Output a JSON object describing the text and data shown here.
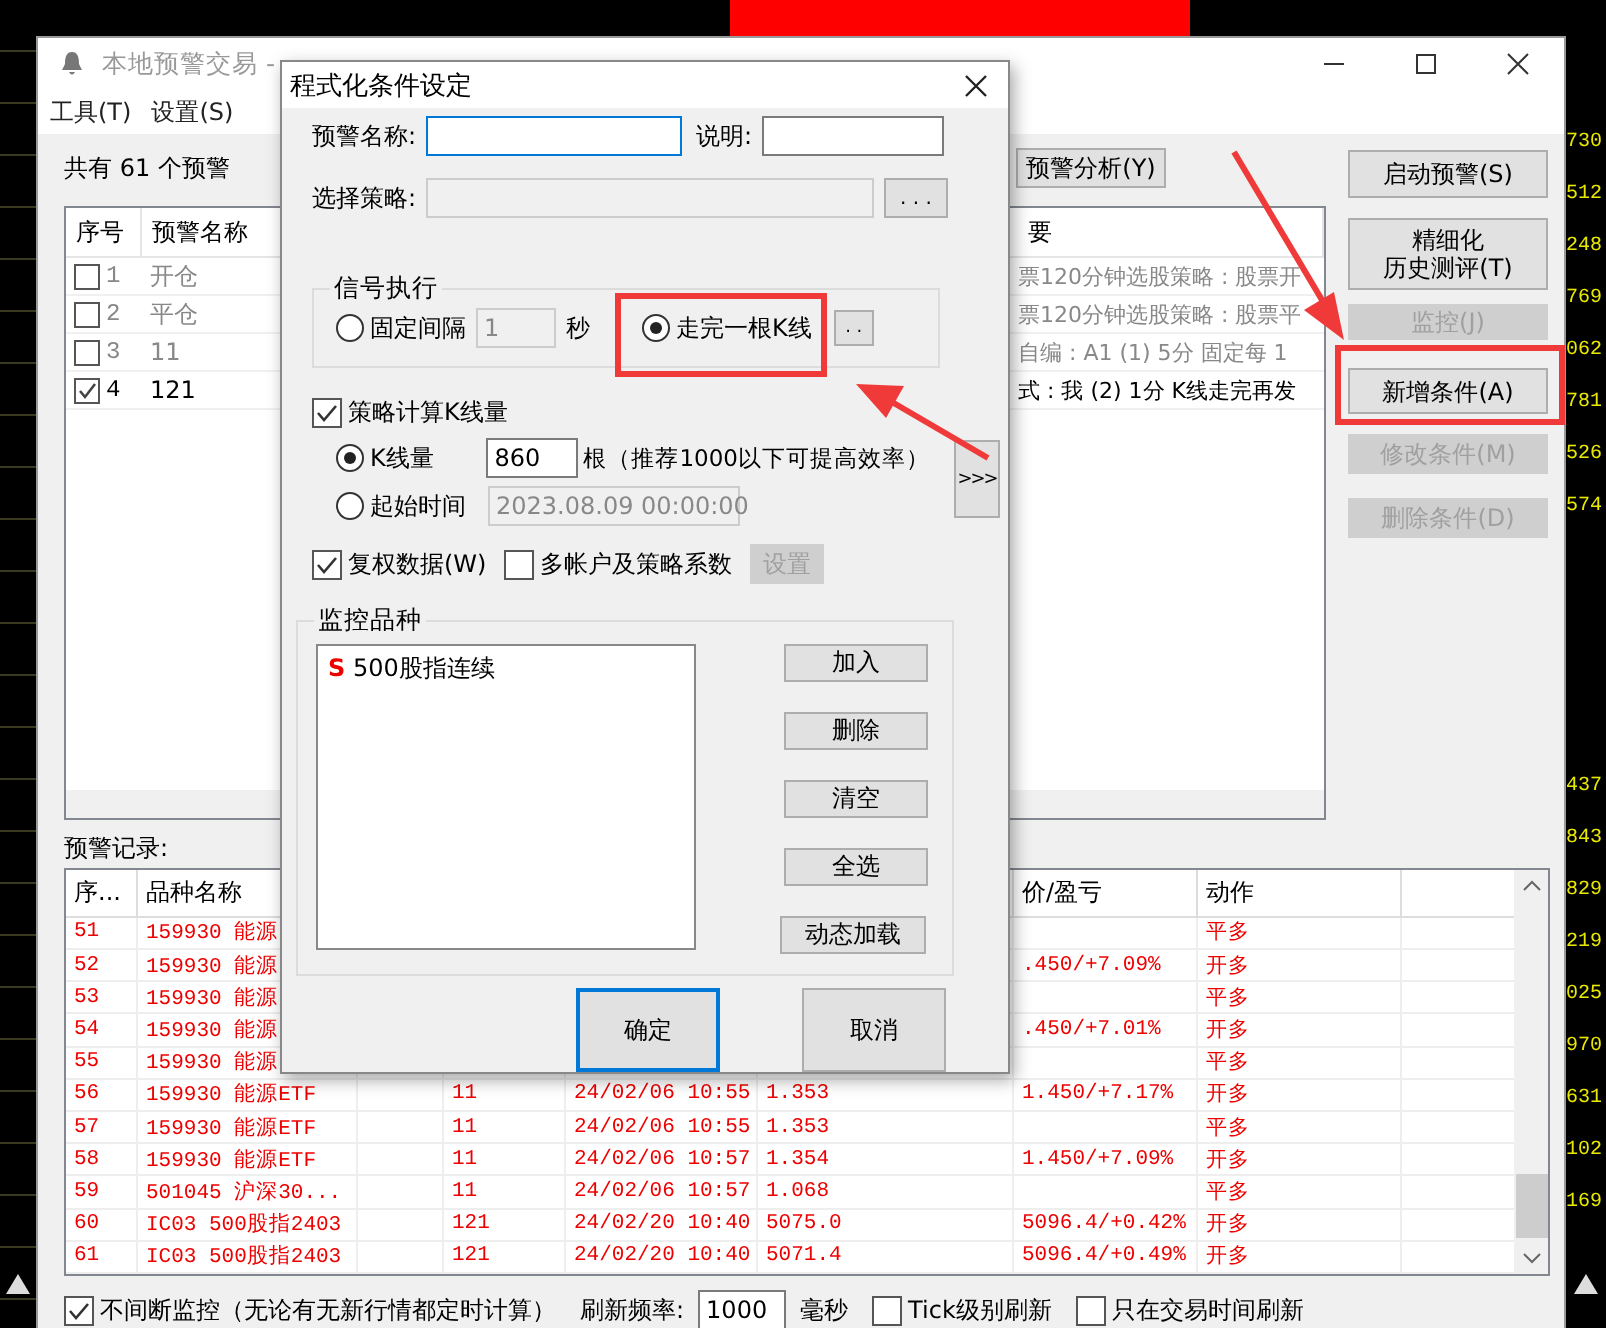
{
  "quotes": {
    "upper": [
      "730",
      "512",
      "248",
      "769",
      "062",
      "781",
      "526",
      "574"
    ],
    "lower": [
      "437",
      "843",
      "829",
      "219",
      "025",
      "970",
      "631",
      "102",
      "169"
    ]
  },
  "main_window": {
    "title": "本地预警交易 -",
    "menu": [
      "工具(T)",
      "设置(S)"
    ],
    "alert_count": "共有 61 个预警",
    "analysis_button": "预警分析(Y)",
    "alerts": {
      "columns": {
        "seq": "序号",
        "name": "预警名称",
        "detail": "要"
      },
      "rows": [
        {
          "seq": "1",
          "name": "开仓",
          "detail": "票120分钟选股策略 : 股票开",
          "checked": false
        },
        {
          "seq": "2",
          "name": "平仓",
          "detail": "票120分钟选股策略 : 股票平",
          "checked": false
        },
        {
          "seq": "3",
          "name": "11",
          "detail": "自编 : A1 (1) 5分 固定每 1",
          "checked": false
        },
        {
          "seq": "4",
          "name": "121",
          "detail": "式 : 我 (2) 1分 K线走完再发",
          "checked": true
        }
      ]
    },
    "side_buttons": [
      {
        "label": "启动预警(S)",
        "disabled": false
      },
      {
        "lines": [
          "精细化",
          "历史测评(T)"
        ],
        "disabled": false
      },
      {
        "label": "监控(J)",
        "disabled": true
      },
      {
        "label": "新增条件(A)",
        "disabled": false
      },
      {
        "label": "修改条件(M)",
        "disabled": true
      },
      {
        "label": "删除条件(D)",
        "disabled": true
      }
    ],
    "records": {
      "label": "预警记录:",
      "columns": {
        "seq": "序...",
        "name": "品种名称",
        "result": "价/盈亏",
        "action": "动作"
      },
      "rows": [
        {
          "seq": "51",
          "name": "159930 能源",
          "action": "平多"
        },
        {
          "seq": "52",
          "name": "159930 能源",
          "result": ".450/+7.09%",
          "action": "开多"
        },
        {
          "seq": "53",
          "name": "159930 能源",
          "action": "平多"
        },
        {
          "seq": "54",
          "name": "159930 能源",
          "result": ".450/+7.01%",
          "action": "开多"
        },
        {
          "seq": "55",
          "name": "159930 能源",
          "action": "平多"
        },
        {
          "seq": "56",
          "name": "159930 能源ETF",
          "alert": "11",
          "time": "24/02/06 10:55",
          "price": "1.353",
          "result": "1.450/+7.17%",
          "action": "开多"
        },
        {
          "seq": "57",
          "name": "159930 能源ETF",
          "alert": "11",
          "time": "24/02/06 10:55",
          "price": "1.353",
          "action": "平多"
        },
        {
          "seq": "58",
          "name": "159930 能源ETF",
          "alert": "11",
          "time": "24/02/06 10:57",
          "price": "1.354",
          "result": "1.450/+7.09%",
          "action": "开多"
        },
        {
          "seq": "59",
          "name": "501045 沪深30...",
          "alert": "11",
          "time": "24/02/06 10:57",
          "price": "1.068",
          "action": "平多"
        },
        {
          "seq": "60",
          "name": "IC03 500股指2403",
          "alert": "121",
          "time": "24/02/20 10:40",
          "price": "5075.0",
          "result": "5096.4/+0.42%",
          "action": "开多"
        },
        {
          "seq": "61",
          "name": "IC03 500股指2403",
          "alert": "121",
          "time": "24/02/20 10:40",
          "price": "5071.4",
          "result": "5096.4/+0.49%",
          "action": "开多"
        }
      ]
    },
    "options": [
      {
        "kind": "checkbox",
        "label": "不间断监控（无论有无新行情都定时计算）",
        "checked": true
      },
      {
        "kind": "field",
        "label": "刷新频率:",
        "value": "1000",
        "unit": "毫秒"
      },
      {
        "kind": "checkbox",
        "label": "Tick级别刷新",
        "checked": false
      },
      {
        "kind": "checkbox",
        "label": "只在交易时间刷新",
        "checked": false
      }
    ]
  },
  "dialog": {
    "title": "程式化条件设定",
    "name_label": "预警名称:",
    "note_label": "说明:",
    "strategy_label": "选择策略:",
    "browse": ". . .",
    "signal": {
      "title": "信号执行",
      "interval": "1",
      "unit": "秒",
      "more": ". .",
      "options": [
        {
          "label": "固定间隔",
          "selected": false
        },
        {
          "label": "走完一根K线",
          "selected": true
        }
      ]
    },
    "kline": {
      "label": "策略计算K线量",
      "checked": true,
      "modes": [
        {
          "label": "K线量",
          "selected": true,
          "value": "860",
          "note": "根（推荐1000以下可提高效率）"
        },
        {
          "label": "起始时间",
          "selected": false,
          "value": "2023.08.09 00:00:00"
        }
      ]
    },
    "extras": [
      {
        "label": "复权数据(W)",
        "checked": true
      },
      {
        "label": "多帐户及策略系数",
        "checked": false
      }
    ],
    "settings_button": {
      "label": "设置",
      "disabled": true
    },
    "expand": ">>>",
    "symbols": {
      "title": "监控品种",
      "items": [
        {
          "tag": "S",
          "name": "500股指连续"
        }
      ],
      "buttons": [
        "加入",
        "删除",
        "清空",
        "全选",
        "动态加载"
      ]
    },
    "ok": "确定",
    "cancel": "取消"
  }
}
